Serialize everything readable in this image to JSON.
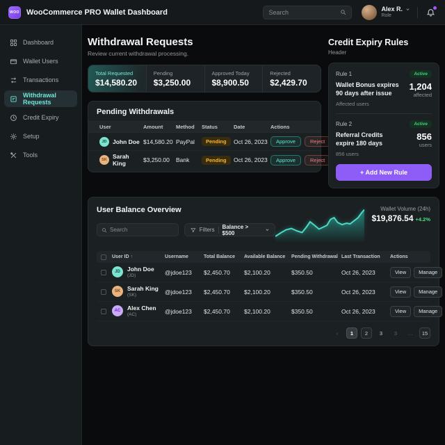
{
  "topbar": {
    "logo_text": "WOO",
    "title": "WooCommerce PRO Wallet Dashboard",
    "search_placeholder": "Search",
    "user_name": "Alex R.",
    "user_role": "Role"
  },
  "sidebar": {
    "items": [
      {
        "label": "Dashboard"
      },
      {
        "label": "Wallet Users"
      },
      {
        "label": "Transactions"
      },
      {
        "label": "Withdrawal Requests"
      },
      {
        "label": "Credit Expiry"
      },
      {
        "label": "Setup"
      },
      {
        "label": "Tools"
      }
    ]
  },
  "withdrawals": {
    "title": "Withdrawal Requests",
    "subtitle": "Review current withdrawal processing.",
    "stats": [
      {
        "label": "Total Requested",
        "value": "$14,580.20"
      },
      {
        "label": "Pending",
        "value": "$3,250.00"
      },
      {
        "label": "Approved Today",
        "value": "$8,900.50"
      },
      {
        "label": "Rejected",
        "value": "$2,429.70"
      }
    ],
    "pending_table": {
      "title": "Pending Withdrawals",
      "headers": [
        "User",
        "Amount",
        "Method",
        "Status",
        "Date",
        "Actions"
      ],
      "approve_label": "Approve",
      "reject_label": "Reject",
      "rows": [
        {
          "user": "John Doe",
          "initials": "JD",
          "avatar_style": "background:#7ce3cf;color:#0f4c43;",
          "amount": "$14,580.20",
          "method": "PayPal",
          "status": "Pending",
          "date": "Oct 26, 2023"
        },
        {
          "user": "Sarah King",
          "initials": "SK",
          "avatar_style": "background:#e9b27f;color:#7a4a1c;",
          "amount": "$3,250.00",
          "method": "Bank",
          "status": "Pending",
          "date": "Oct 26, 2023"
        }
      ]
    }
  },
  "credit_rules": {
    "title": "Credit Expiry Rules",
    "subtitle": "Header",
    "rules": [
      {
        "name": "Rule 1",
        "status": "Active",
        "description": "Wallet Bonus expires 90 days after issue",
        "note": "Affected users",
        "stat_value": "1,204",
        "stat_label": "affected"
      },
      {
        "name": "Rule 2",
        "status": "Active",
        "description": "Referral Credits expire 180 days",
        "note": "856 users",
        "stat_value": "856",
        "stat_label": "users"
      }
    ],
    "add_button": "+ Add New Rule"
  },
  "balance_overview": {
    "title": "User Balance Overview",
    "search_placeholder": "Search",
    "filters_label": "Filters",
    "filter_value": "Balance > $500",
    "volume_label": "Wallet Volume (24h)",
    "volume_value": "$19,876.54",
    "volume_change": "+4.2%",
    "sparkline": [
      [
        0,
        82
      ],
      [
        6,
        72
      ],
      [
        12,
        63
      ],
      [
        18,
        59
      ],
      [
        24,
        66
      ],
      [
        30,
        71
      ],
      [
        35,
        55
      ],
      [
        39,
        40
      ],
      [
        44,
        50
      ],
      [
        49,
        61
      ],
      [
        54,
        55
      ],
      [
        58,
        50
      ],
      [
        62,
        33
      ],
      [
        66,
        28
      ],
      [
        70,
        42
      ],
      [
        75,
        48
      ],
      [
        80,
        44
      ],
      [
        84,
        46
      ],
      [
        88,
        38
      ],
      [
        93,
        28
      ],
      [
        97,
        14
      ],
      [
        100,
        5
      ]
    ],
    "table": {
      "headers": [
        "User ID",
        "Username",
        "Total Balance",
        "Available Balance",
        "Pending Withdrawal",
        "Last Transaction",
        "Actions"
      ],
      "sort_indicator": "↑",
      "view_label": "View",
      "manage_label": "Manage",
      "rows": [
        {
          "name": "John Doe",
          "sub": "(JD)",
          "initials": "JD",
          "avatar_style": "background:#7ce3cf;color:#0f4c43;",
          "username": "@jdoe123",
          "total": "$2,450.70",
          "available": "$2,100.20",
          "pending": "$350.50",
          "last_tx": "Oct 26, 2023"
        },
        {
          "name": "Sarah King",
          "sub": "(SK)",
          "initials": "SK",
          "avatar_style": "background:#e9b27f;color:#7a4a1c;",
          "username": "@jdoe123",
          "total": "$2,450.70",
          "available": "$2,100.20",
          "pending": "$350.50",
          "last_tx": "Oct 26, 2023"
        },
        {
          "name": "Alex Chen",
          "sub": "(AC)",
          "initials": "AC",
          "avatar_style": "background:#cbaaf7;color:#6d28d9;",
          "username": "@jdoe123",
          "total": "$2,450.70",
          "available": "$2,100.20",
          "pending": "$350.50",
          "last_tx": "Oct 26, 2023"
        }
      ]
    },
    "pagination": [
      {
        "label": "‹"
      },
      {
        "label": "1"
      },
      {
        "label": "2"
      },
      {
        "label": "3"
      },
      {
        "label": "3"
      },
      {
        "label": "…"
      },
      {
        "label": "15"
      }
    ]
  },
  "chart_data": {
    "type": "area",
    "title": "Wallet Volume (24h)",
    "current_value": "$19,876.54",
    "change": "+4.2%",
    "x": [
      0,
      6,
      12,
      18,
      24,
      30,
      35,
      39,
      44,
      49,
      54,
      58,
      62,
      66,
      70,
      75,
      80,
      84,
      88,
      93,
      97,
      100
    ],
    "values": [
      18,
      28,
      37,
      41,
      34,
      29,
      45,
      60,
      50,
      39,
      45,
      50,
      67,
      72,
      58,
      52,
      56,
      54,
      62,
      72,
      86,
      95
    ],
    "xlabel": "",
    "ylabel": "",
    "legend": false,
    "grid": false
  },
  "colors": {
    "accent_teal": "#2dd4bf",
    "accent_purple": "#8e5cf6",
    "pending_amber": "#f3b72e",
    "active_green": "#49d17d",
    "positive_green": "#4ade80",
    "reject_red": "#f07e7e"
  }
}
